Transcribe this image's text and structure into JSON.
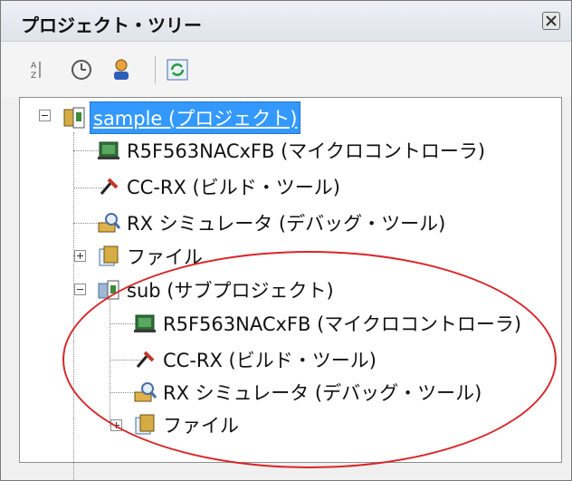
{
  "panel": {
    "title": "プロジェクト・ツリー",
    "close_icon": "close-icon"
  },
  "toolbar": {
    "buttons": [
      {
        "icon": "sort-icon"
      },
      {
        "icon": "clock-icon"
      },
      {
        "icon": "user-icon"
      },
      {
        "icon": "refresh-icon"
      }
    ]
  },
  "tree": {
    "project": {
      "label": "sample (プロジェクト)",
      "icon": "project-icon"
    },
    "items": [
      {
        "label": "R5F563NACxFB (マイクロコントローラ)",
        "icon": "microcontroller-icon"
      },
      {
        "label": "CC-RX (ビルド・ツール)",
        "icon": "build-tool-icon"
      },
      {
        "label": "RX シミュレータ (デバッグ・ツール)",
        "icon": "debug-tool-icon"
      },
      {
        "label": "ファイル",
        "icon": "file-folder-icon"
      }
    ],
    "subproject": {
      "label": "sub (サブプロジェクト)",
      "icon": "subproject-icon"
    },
    "subitems": [
      {
        "label": "R5F563NACxFB (マイクロコントローラ)",
        "icon": "microcontroller-icon"
      },
      {
        "label": "CC-RX (ビルド・ツール)",
        "icon": "build-tool-icon"
      },
      {
        "label": "RX シミュレータ (デバッグ・ツール)",
        "icon": "debug-tool-icon"
      },
      {
        "label": "ファイル",
        "icon": "file-folder-icon"
      }
    ]
  },
  "colors": {
    "selection": "#3399ff",
    "highlight_ellipse": "#d9262a"
  }
}
